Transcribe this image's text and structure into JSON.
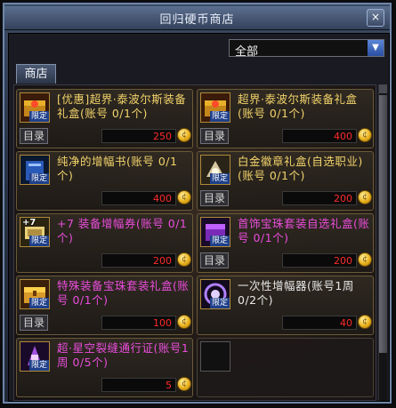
{
  "window": {
    "title": "回归硬币商店",
    "close_label": "×"
  },
  "filter": {
    "selected": "全部",
    "arrow_label": "▼"
  },
  "tab": {
    "label": "商店"
  },
  "labels": {
    "catalog": "目录",
    "limited": "限定",
    "coin": "¢"
  },
  "items": [
    {
      "name": "[优惠]超界·泰波尔斯装备礼盒(账号 0/1个)",
      "price": "250",
      "has_catalog": true,
      "color": "gold",
      "icon": "treasure-box-icon"
    },
    {
      "name": "超界·泰波尔斯装备礼盒(账号 0/1个)",
      "price": "400",
      "has_catalog": true,
      "color": "gold",
      "icon": "treasure-box-icon"
    },
    {
      "name": "纯净的增幅书(账号 0/1个)",
      "price": "400",
      "has_catalog": false,
      "color": "gold",
      "icon": "blue-book-icon"
    },
    {
      "name": "白金徽章礼盒(自选职业)(账号 0/1个)",
      "price": "200",
      "has_catalog": true,
      "color": "gold",
      "icon": "platinum-box-icon"
    },
    {
      "name": "+7 装备增幅券(账号 0/1个)",
      "price": "200",
      "has_catalog": false,
      "color": "pink",
      "icon": "amplify-ticket-icon",
      "plus": "+7"
    },
    {
      "name": "首饰宝珠套装自选礼盒(账号 0/1个)",
      "price": "200",
      "has_catalog": true,
      "color": "pink",
      "icon": "purple-box-icon"
    },
    {
      "name": "特殊装备宝珠套装礼盒(账号 0/1个)",
      "price": "100",
      "has_catalog": true,
      "color": "pink",
      "icon": "gold-chest-icon"
    },
    {
      "name": "一次性增幅器(账号1周 0/2个)",
      "price": "40",
      "has_catalog": false,
      "color": "white",
      "icon": "amplifier-icon"
    },
    {
      "name": "超·星空裂缝通行证(账号1周 0/5个)",
      "price": "5",
      "has_catalog": false,
      "color": "pink",
      "icon": "pass-icon"
    }
  ],
  "colors": {
    "price": "#ff2a2a",
    "gold_text": "#f2d36a",
    "pink_text": "#ea4ddc",
    "limited_tag": "#1e3f8a"
  }
}
